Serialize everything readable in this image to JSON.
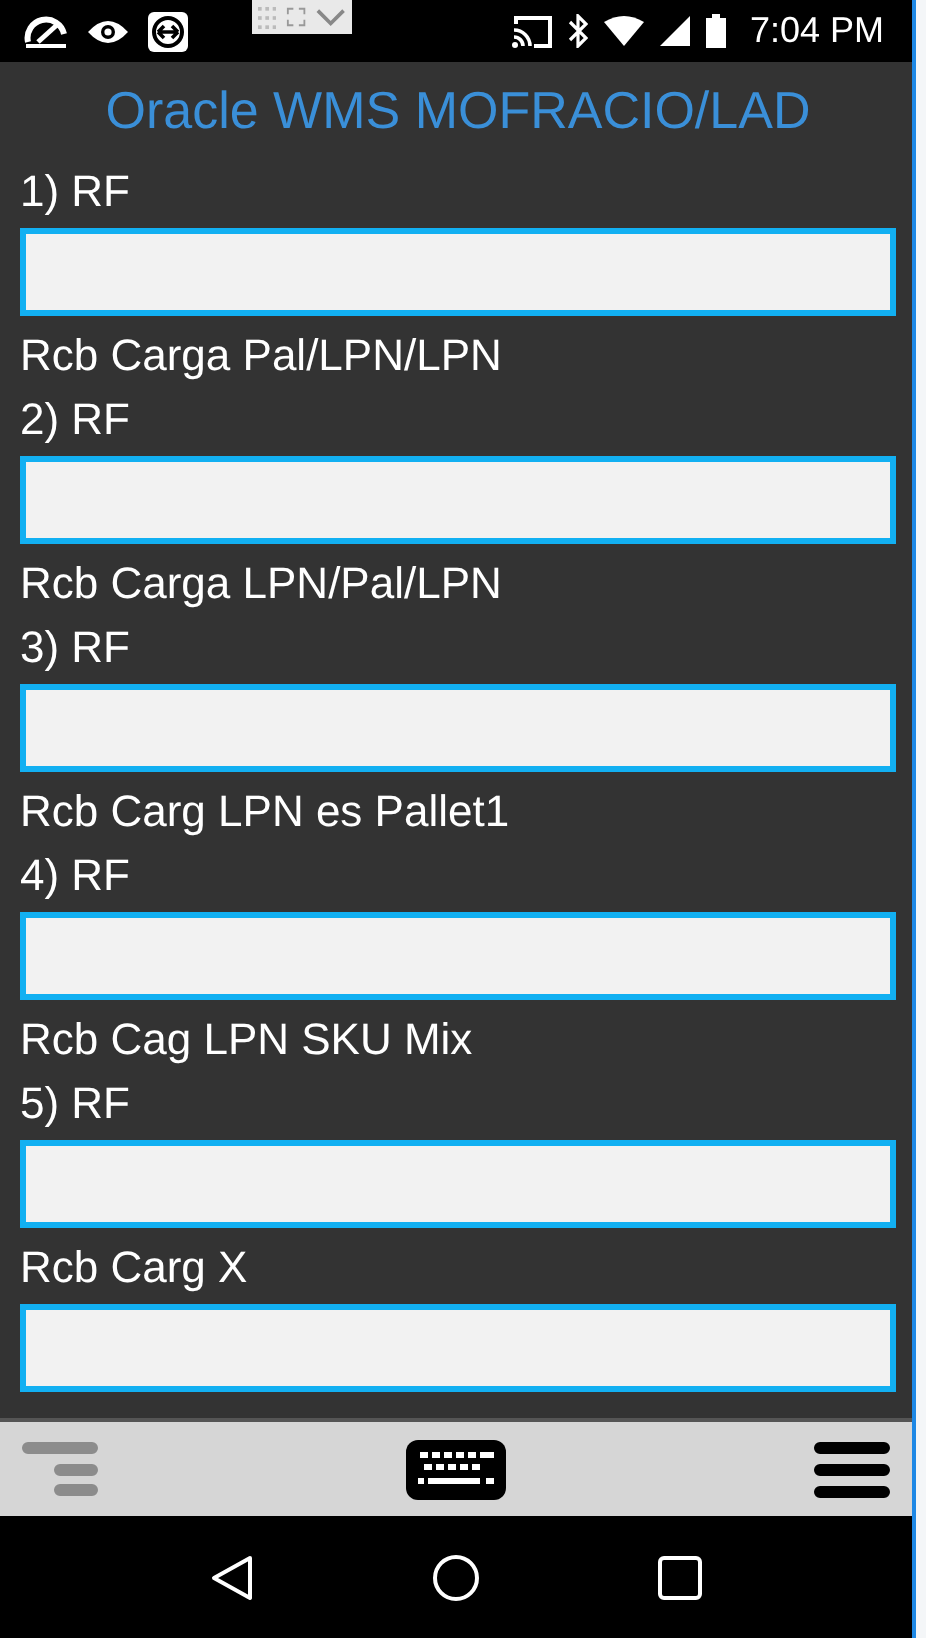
{
  "status_bar": {
    "time": "7:04 PM"
  },
  "title": "Oracle WMS MOFRACIO/LAD",
  "fields": [
    {
      "lines": [
        "1) RF"
      ]
    },
    {
      "lines": [
        "Rcb Carga Pal/LPN/LPN",
        "2) RF"
      ]
    },
    {
      "lines": [
        "Rcb Carga LPN/Pal/LPN",
        "3) RF"
      ]
    },
    {
      "lines": [
        "Rcb Carg LPN es Pallet1",
        "4) RF"
      ]
    },
    {
      "lines": [
        "Rcb Cag LPN SKU Mix",
        "5) RF"
      ]
    },
    {
      "lines": [
        "Rcb Carg X"
      ]
    }
  ]
}
